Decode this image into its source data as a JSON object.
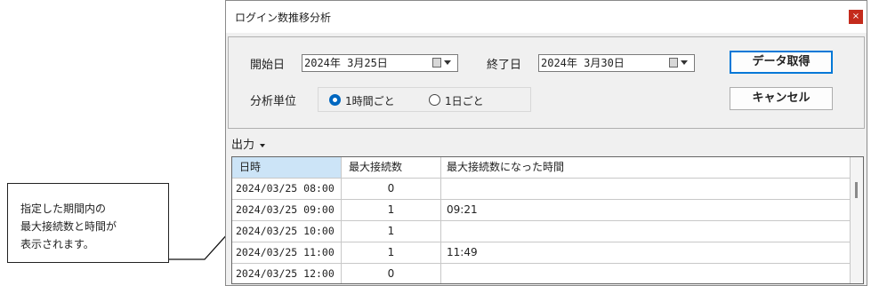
{
  "callout": {
    "lines": [
      "指定した期間内の",
      "最大接続数と時間が",
      "表示されます。"
    ]
  },
  "window": {
    "title": "ログイン数推移分析",
    "close_label": "×"
  },
  "form": {
    "start_label": "開始日",
    "start_value": "2024年 3月25日",
    "end_label": "終了日",
    "end_value": "2024年 3月30日",
    "fetch_button": "データ取得",
    "cancel_button": "キャンセル",
    "unit_label": "分析単位",
    "unit_options": [
      {
        "label": "1時間ごと",
        "selected": true
      },
      {
        "label": "1日ごと",
        "selected": false
      }
    ]
  },
  "output_menu": "出力",
  "table": {
    "columns": [
      "日時",
      "最大接続数",
      "最大接続数になった時間"
    ],
    "rows": [
      [
        "2024/03/25 08:00",
        "0",
        ""
      ],
      [
        "2024/03/25 09:00",
        "1",
        "09:21"
      ],
      [
        "2024/03/25 10:00",
        "1",
        ""
      ],
      [
        "2024/03/25 11:00",
        "1",
        "11:49"
      ],
      [
        "2024/03/25 12:00",
        "0",
        ""
      ]
    ]
  },
  "colors": {
    "accent": "#0078d7",
    "selected_header": "#cce4f7",
    "close": "#c42b1c"
  }
}
